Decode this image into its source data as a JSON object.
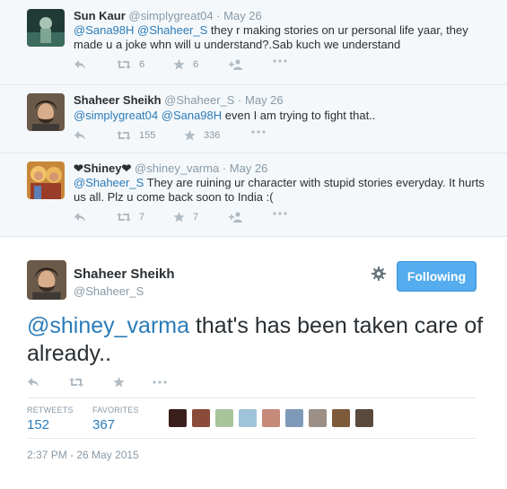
{
  "replies": [
    {
      "name": "Sun Kaur",
      "handle": "@simplygreat04",
      "dot": "·",
      "date": "May 26",
      "text_parts": [
        "@Sana98H",
        " ",
        "@Shaheer_S",
        " they r making stories on ur personal life yaar, they made u a joke whn will u understand?.Sab kuch we understand"
      ],
      "retweets": "6",
      "favorites": "6"
    },
    {
      "name": "Shaheer Sheikh",
      "handle": "@Shaheer_S",
      "dot": "·",
      "date": "May 26",
      "text_parts": [
        "@simplygreat04",
        " ",
        "@Sana98H",
        " even I am trying to fight that.."
      ],
      "retweets": "155",
      "favorites": "336"
    },
    {
      "name": "❤Shiney❤",
      "handle": "@shiney_varma",
      "dot": "·",
      "date": "May 26",
      "text_parts": [
        "@Shaheer_S",
        " They are ruining ur character with stupid stories everyday. It hurts us all. Plz u come back soon to India :("
      ],
      "retweets": "7",
      "favorites": "7"
    }
  ],
  "main": {
    "name": "Shaheer Sheikh",
    "handle": "@Shaheer_S",
    "follow_label": "Following",
    "mention": "@shiney_varma",
    "text": " that's has been taken care of already..",
    "retweets_label": "RETWEETS",
    "retweets_value": "152",
    "favorites_label": "FAVORITES",
    "favorites_value": "367",
    "timestamp": "2:37 PM - 26 May 2015"
  },
  "icons": {
    "reply": "reply-arrow-icon",
    "retweet": "retweet-icon",
    "favorite": "star-icon",
    "follow": "follow-user-icon",
    "more": "more-dots-icon",
    "settings": "gear-icon"
  },
  "colors": {
    "link": "#2b7bb9",
    "button": "#55acee",
    "muted": "#8899a6",
    "icon": "#b1bbc3",
    "thread_bg": "#f5f8fa"
  }
}
